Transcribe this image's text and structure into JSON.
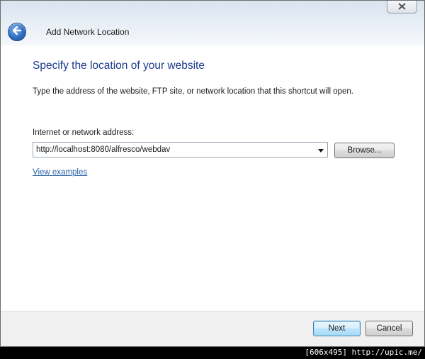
{
  "window": {
    "title": "Add Network Location"
  },
  "page": {
    "heading": "Specify the location of your website",
    "instruction": "Type the address of the website, FTP site, or network location that this shortcut will open."
  },
  "address": {
    "label": "Internet or network address:",
    "value": "http://localhost:8080/alfresco/webdav",
    "browse_label": "Browse..."
  },
  "link": {
    "view_examples": "View examples"
  },
  "footer": {
    "next_label": "Next",
    "cancel_label": "Cancel"
  },
  "watermark": {
    "text": "[606x495] http://upic.me/"
  },
  "icons": {
    "close": "close-icon",
    "back": "back-arrow-icon",
    "dropdown": "chevron-down-icon"
  },
  "colors": {
    "heading": "#1e3b8c",
    "link": "#2a62a8",
    "next_button_border": "#3c7fb1"
  }
}
